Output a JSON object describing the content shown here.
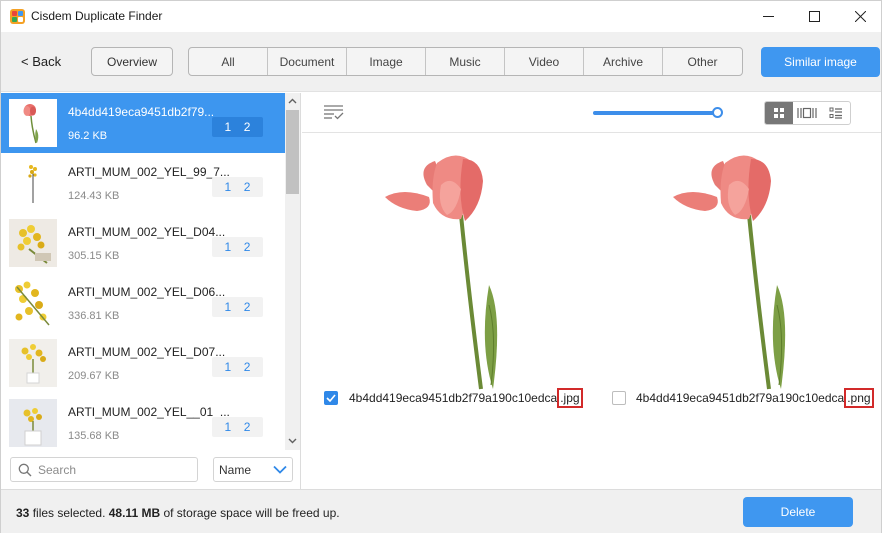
{
  "window": {
    "title": "Cisdem Duplicate Finder",
    "minimize_icon": "minimize-icon",
    "maximize_icon": "maximize-icon",
    "close_icon": "close-icon"
  },
  "toolbar": {
    "back_label": "< Back",
    "overview_label": "Overview",
    "tabs": [
      {
        "label": "All"
      },
      {
        "label": "Document"
      },
      {
        "label": "Image"
      },
      {
        "label": "Music"
      },
      {
        "label": "Video"
      },
      {
        "label": "Archive"
      },
      {
        "label": "Other"
      }
    ],
    "similar_label": "Similar image"
  },
  "file_list": {
    "items": [
      {
        "name": "4b4dd419eca9451db2f79...",
        "size": "96.2 KB",
        "count_a": "1",
        "count_b": "2",
        "selected": true
      },
      {
        "name": "ARTI_MUM_002_YEL_99_7...",
        "size": "124.43 KB",
        "count_a": "1",
        "count_b": "2"
      },
      {
        "name": "ARTI_MUM_002_YEL_D04...",
        "size": "305.15 KB",
        "count_a": "1",
        "count_b": "2"
      },
      {
        "name": "ARTI_MUM_002_YEL_D06...",
        "size": "336.81 KB",
        "count_a": "1",
        "count_b": "2"
      },
      {
        "name": "ARTI_MUM_002_YEL_D07...",
        "size": "209.67 KB",
        "count_a": "1",
        "count_b": "2"
      },
      {
        "name": "ARTI_MUM_002_YEL__01_...",
        "size": "135.68 KB",
        "count_a": "1",
        "count_b": "2"
      }
    ],
    "search_placeholder": "Search",
    "sort_value": "Name"
  },
  "preview": {
    "zoom_level": 0.96,
    "files": [
      {
        "name": "4b4dd419eca9451db2f79a190c10edca",
        "ext": ".jpg",
        "checked": true
      },
      {
        "name": "4b4dd419eca9451db2f79a190c10edca",
        "ext": ".png",
        "checked": false
      }
    ]
  },
  "footer": {
    "count": "33",
    "count_text": "files selected.",
    "size": "48.11 MB",
    "size_text": "of storage space will be freed up.",
    "delete_label": "Delete"
  },
  "colors": {
    "accent": "#3f97f0",
    "highlight_border": "#d22a2a"
  }
}
